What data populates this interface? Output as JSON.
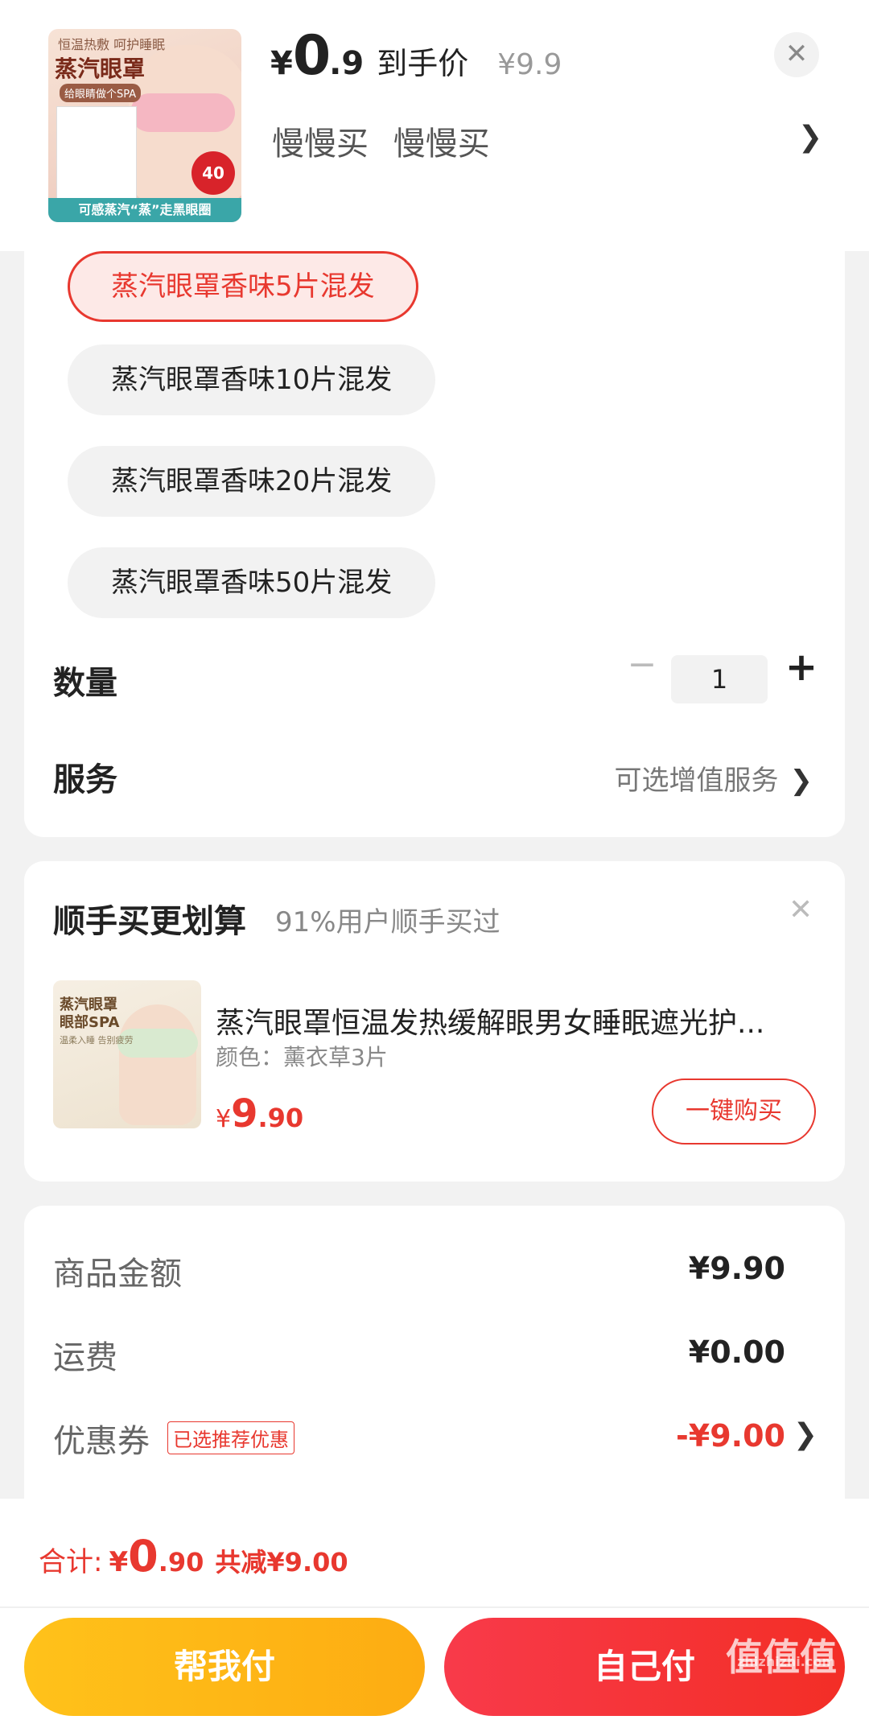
{
  "header": {
    "thumbnail": {
      "top_text": "恒温热敷 呵护睡眠",
      "title": "蒸汽眼罩",
      "subtitle": "给眼睛做个SPA",
      "badge": "40",
      "bottom_text": "可感蒸汽“蒸”走黑眼圈"
    },
    "price": {
      "currency": "¥",
      "integer": "0",
      "decimal": ".9",
      "tag": "到手价",
      "original": "¥9.9"
    },
    "selected_variant": [
      "慢慢买",
      "慢慢买"
    ],
    "close_icon": "✕",
    "chevron": "❯"
  },
  "options": {
    "chips": [
      {
        "label": "蒸汽眼罩香味5片混发",
        "selected": true
      },
      {
        "label": "蒸汽眼罩香味10片混发",
        "selected": false
      },
      {
        "label": "蒸汽眼罩香味20片混发",
        "selected": false
      },
      {
        "label": "蒸汽眼罩香味50片混发",
        "selected": false
      }
    ],
    "quantity_label": "数量",
    "quantity_value": "1",
    "minus": "−",
    "plus": "+",
    "service_label": "服务",
    "service_value": "可选增值服务",
    "chevron": "❯"
  },
  "bundle": {
    "title": "顺手买更划算",
    "subtitle": "91%用户顺手买过",
    "close_icon": "✕",
    "thumb_text": "蒸汽眼罩\n眼部SPA",
    "thumb_sub": "温柔入睡 告别疲劳",
    "name": "蒸汽眼罩恒温发热缓解眼男女睡眠遮光护...",
    "spec": "颜色：薰衣草3片",
    "price": {
      "currency": "¥",
      "integer": "9",
      "decimal": ".90"
    },
    "buy_button": "一键购买"
  },
  "summary": {
    "rows": [
      {
        "label": "商品金额",
        "value": "¥9.90"
      },
      {
        "label": "运费",
        "value": "¥0.00"
      },
      {
        "label": "优惠券",
        "tag": "已选推荐优惠",
        "value": "-¥9.00"
      }
    ],
    "chevron": "❯"
  },
  "footer": {
    "total_label": "合计:",
    "total": {
      "currency": "¥",
      "integer": "0",
      "decimal": ".90"
    },
    "savings": "共减¥9.00",
    "help_pay": "帮我付",
    "self_pay": "自己付",
    "watermark": "值值值",
    "watermark_sub": "zhizhizhi.com"
  },
  "colors": {
    "accent": "#e8382f",
    "yellow": "#fdb415",
    "red": "#f5333a"
  }
}
